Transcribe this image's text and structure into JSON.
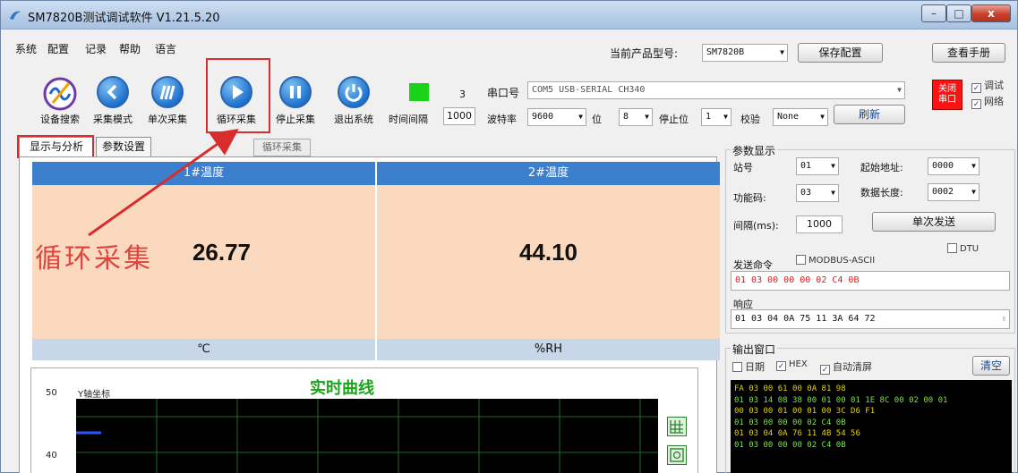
{
  "window": {
    "title": "SM7820B测试调试软件  V1.21.5.20",
    "buttons": {
      "minimize": "–",
      "maximize": "□",
      "close": "x"
    }
  },
  "menu": [
    "系统",
    "配置",
    "记录",
    "帮助",
    "语言"
  ],
  "product": {
    "label": "当前产品型号:",
    "model": "SM7820B",
    "save_config": "保存配置",
    "manual": "查看手册"
  },
  "toolbar": [
    {
      "label": "设备搜索",
      "icon": "device-search-icon"
    },
    {
      "label": "采集模式",
      "icon": "share-icon"
    },
    {
      "label": "单次采集",
      "icon": "single-collect-icon"
    },
    {
      "label": "循环采集",
      "icon": "play-icon"
    },
    {
      "label": "停止采集",
      "icon": "pause-icon"
    },
    {
      "label": "退出系统",
      "icon": "power-icon"
    }
  ],
  "interval": {
    "label": "时间间隔",
    "value": "1000",
    "count": "3"
  },
  "serial": {
    "port_label": "串口号",
    "port_value": "COM5 USB-SERIAL CH340",
    "baud_label": "波特率",
    "baud_value": "9600",
    "bits_label": "位",
    "bits_value": "8",
    "stop_label": "停止位",
    "stop_value": "1",
    "parity_label": "校验",
    "parity_value": "None",
    "refresh": "刷新",
    "close_port": "关闭\n串口",
    "debug_label": "调试",
    "network_label": "网络"
  },
  "tabs": [
    "显示与分析",
    "参数设置"
  ],
  "loop_status": "循环采集",
  "cards": [
    {
      "title": "1#温度",
      "value": "26.77",
      "unit": "℃"
    },
    {
      "title": "2#温度",
      "value": "44.10",
      "unit": "%RH"
    }
  ],
  "annotation": "循环采集",
  "chart": {
    "title": "实时曲线",
    "ylabel": "Y轴坐标",
    "yticks": [
      "50",
      "40"
    ]
  },
  "params": {
    "group_title": "参数显示",
    "station_label": "站号",
    "station_value": "01",
    "start_addr_label": "起始地址:",
    "start_addr_value": "0000",
    "func_label": "功能码:",
    "func_value": "03",
    "data_len_label": "数据长度:",
    "data_len_value": "0002",
    "interval_label": "间隔(ms):",
    "interval_value": "1000",
    "single_send": "单次发送",
    "dtu_label": "DTU",
    "send_cmd_label": "发送命令",
    "modbus_ascii_label": "MODBUS-ASCII",
    "send_cmd_value": "01 03 00 00 00 02 C4 0B",
    "response_label": "响应",
    "response_value": "01 03 04 0A 75 11 3A 64 72"
  },
  "output": {
    "group_title": "输出窗口",
    "date_label": "日期",
    "hex_label": "HEX",
    "auto_clear_label": "自动清屏",
    "clear_button": "清空",
    "lines": [
      "FA 03 00 61 00 0A 81 98",
      "01 03 14 08 38 00 01 00 01 1E 8C 00 02 00 01",
      "00 03 00 01 00 01 00 3C D6 F1",
      "01 03 00 00 00 02 C4 0B",
      "01 03 04 0A 76 11 4B 54 56",
      "01 03 00 00 00 02 C4 0B"
    ]
  },
  "colors": {
    "card_header": "#3c7fcc",
    "card_body": "#fbd9bf",
    "status_green": "#19d219",
    "close_port_red": "#ff1212",
    "highlight_red": "#d92d2d",
    "chart_title_green": "#19a519"
  }
}
